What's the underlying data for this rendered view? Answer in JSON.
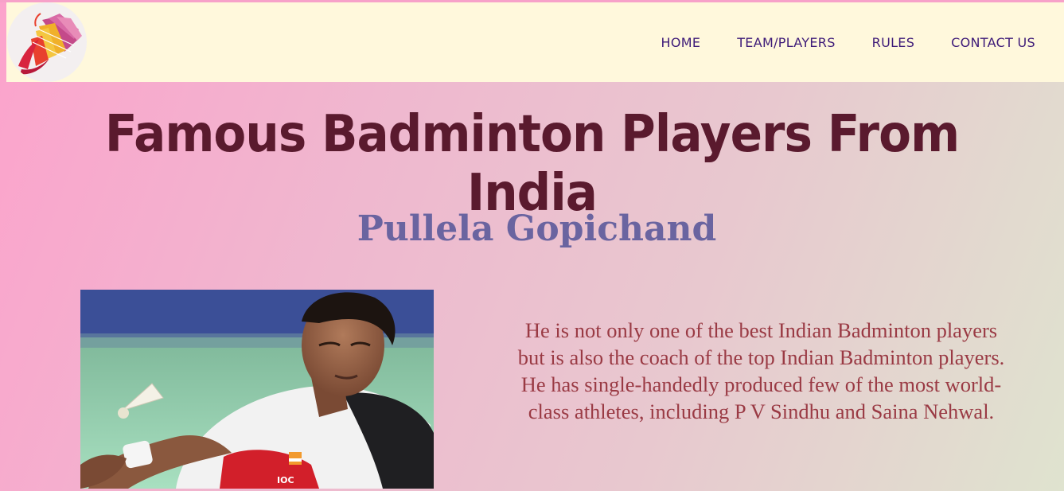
{
  "nav": {
    "items": [
      "HOME",
      "TEAM/PLAYERS",
      "RULES",
      "CONTACT US"
    ]
  },
  "page": {
    "title": "Famous Badminton Players From India"
  },
  "player": {
    "name": "Pullela Gopichand",
    "description": "He is not only one of the best Indian Badminton players but is also the coach of the top Indian Badminton players. He has single-handedly produced few of the most world-class athletes, including P V Sindhu and Saina Nehwal.",
    "jersey_text": "IOC"
  },
  "colors": {
    "nav_text": "#3d1a78",
    "title": "#5a1a2e",
    "player_name": "#6a64a0",
    "description": "#9a3a44",
    "navbar_bg": "#fff8dc"
  },
  "icons": {
    "logo": "shuttlecock-logo-icon"
  }
}
